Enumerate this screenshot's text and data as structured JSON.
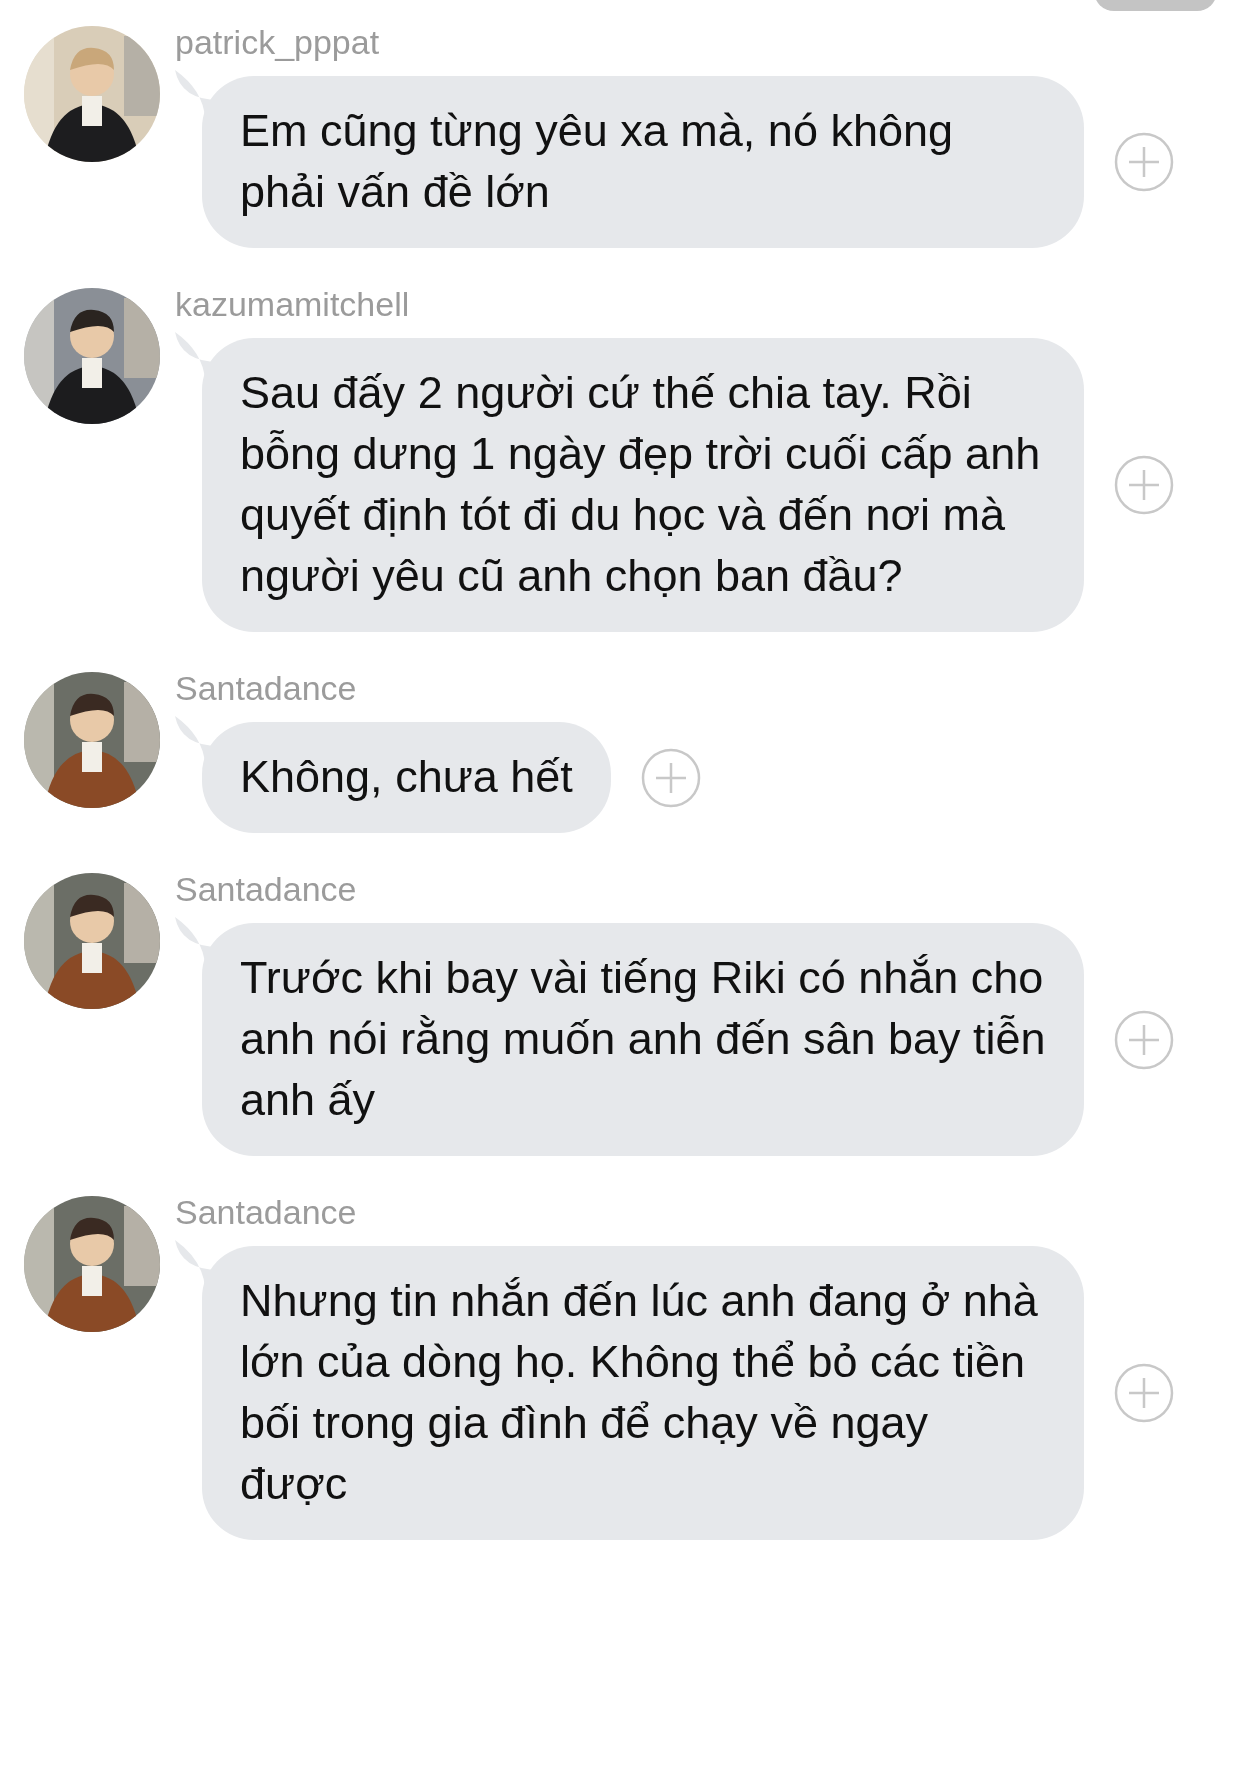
{
  "messages": [
    {
      "username": "patrick_pppat",
      "text": "Em cũng từng yêu xa mà, nó không phải vấn đề lớn"
    },
    {
      "username": "kazumamitchell",
      "text": "Sau đấy 2 người cứ thế chia tay. Rồi bỗng dưng 1 ngày đẹp trời cuối cấp anh quyết định tót đi du học và đến nơi mà người yêu cũ anh chọn ban đầu?"
    },
    {
      "username": "Santadance",
      "text": "Không, chưa hết"
    },
    {
      "username": "Santadance",
      "text": "Trước khi bay vài tiếng Riki có nhắn cho anh nói rằng muốn anh đến sân bay tiễn anh ấy"
    },
    {
      "username": "Santadance",
      "text": "Nhưng tin nhắn đến lúc anh đang ở nhà lớn của dòng họ. Không thể bỏ các tiền bối trong gia đình để chạy về ngay được"
    }
  ]
}
